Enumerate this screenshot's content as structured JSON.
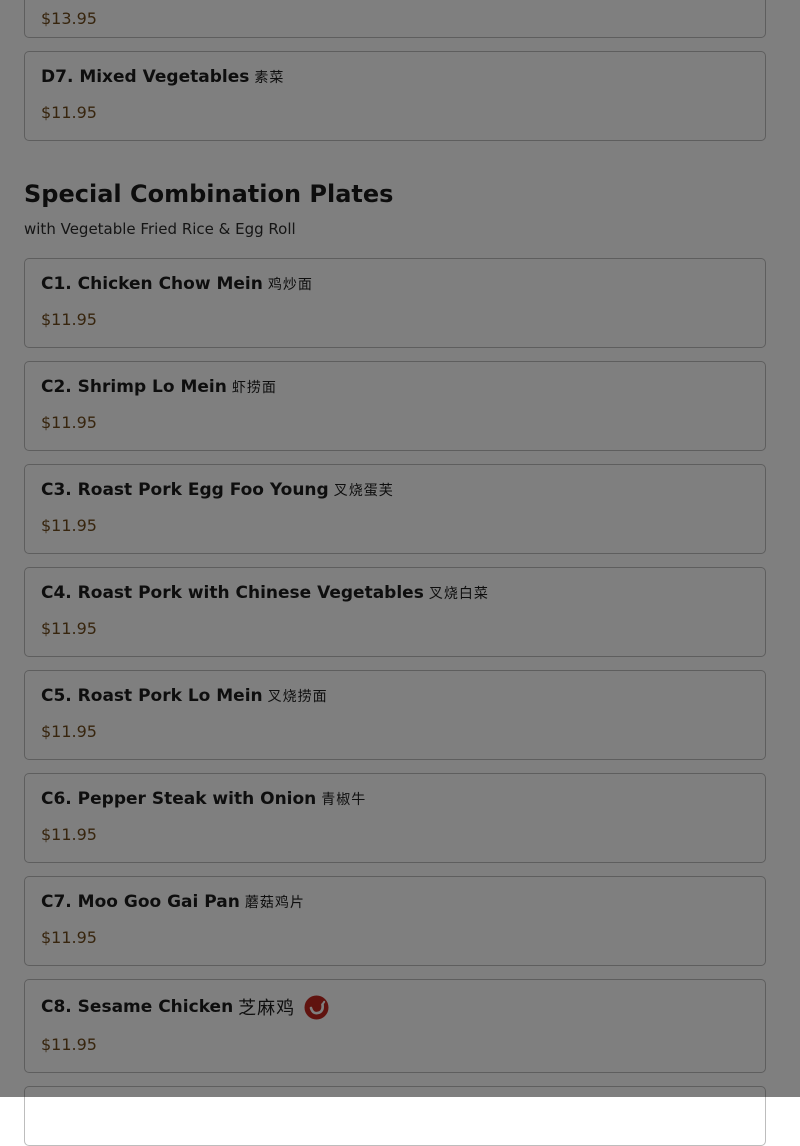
{
  "prev_section": {
    "partial_price": "$13.95",
    "items": [
      {
        "name": "D7. Mixed Vegetables",
        "cn": "素菜",
        "price": "$11.95"
      }
    ]
  },
  "section": {
    "title": "Special Combination Plates",
    "subtitle": "with Vegetable Fried Rice & Egg Roll",
    "items": [
      {
        "name": "C1. Chicken Chow Mein",
        "cn": "鸡炒面",
        "price": "$11.95"
      },
      {
        "name": "C2. Shrimp Lo Mein",
        "cn": "虾捞面",
        "price": "$11.95"
      },
      {
        "name": "C3. Roast Pork Egg Foo Young",
        "cn": "叉烧蛋芙",
        "price": "$11.95"
      },
      {
        "name": "C4. Roast Pork with Chinese Vegetables",
        "cn": "叉烧白菜",
        "price": "$11.95"
      },
      {
        "name": "C5. Roast Pork Lo Mein",
        "cn": "叉烧捞面",
        "price": "$11.95"
      },
      {
        "name": "C6. Pepper Steak with Onion",
        "cn": "青椒牛",
        "price": "$11.95"
      },
      {
        "name": "C7. Moo Goo Gai Pan",
        "cn": "蘑菇鸡片",
        "price": "$11.95"
      },
      {
        "name": "C8. Sesame Chicken",
        "cn": "芝麻鸡",
        "price": "$11.95",
        "spicy_icon": "hot-pepper-icon"
      }
    ]
  },
  "colors": {
    "price": "#6e4a1c",
    "border": "#bdbdbd",
    "spicy_badge": "#c0261e",
    "overlay": "rgba(0,0,0,0.5)"
  }
}
